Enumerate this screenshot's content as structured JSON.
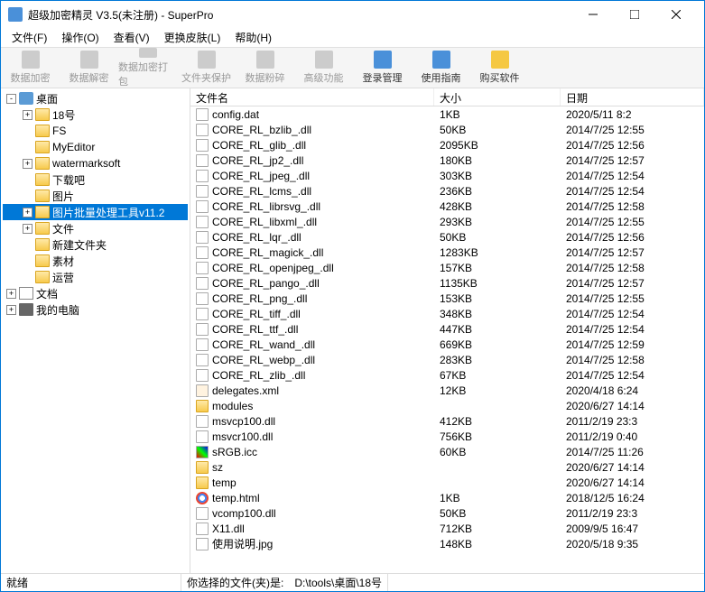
{
  "window": {
    "title": "超级加密精灵 V3.5(未注册) - SuperPro"
  },
  "menus": [
    {
      "label": "文件(F)"
    },
    {
      "label": "操作(O)"
    },
    {
      "label": "查看(V)"
    },
    {
      "label": "更换皮肤(L)"
    },
    {
      "label": "帮助(H)"
    }
  ],
  "toolbar": [
    {
      "label": "数据加密",
      "enabled": false
    },
    {
      "label": "数据解密",
      "enabled": false
    },
    {
      "label": "数据加密打包",
      "enabled": false
    },
    {
      "label": "文件夹保护",
      "enabled": false
    },
    {
      "label": "数据粉碎",
      "enabled": false
    },
    {
      "label": "高级功能",
      "enabled": false
    },
    {
      "label": "登录管理",
      "enabled": true
    },
    {
      "label": "使用指南",
      "enabled": true
    },
    {
      "label": "购买软件",
      "enabled": true,
      "yellow": true
    }
  ],
  "tree": [
    {
      "depth": 0,
      "exp": "-",
      "icon": "desktop",
      "label": "桌面"
    },
    {
      "depth": 1,
      "exp": "+",
      "icon": "folder",
      "label": "18号"
    },
    {
      "depth": 1,
      "exp": "",
      "icon": "folder",
      "label": "FS"
    },
    {
      "depth": 1,
      "exp": "",
      "icon": "folder",
      "label": "MyEditor"
    },
    {
      "depth": 1,
      "exp": "+",
      "icon": "folder",
      "label": "watermarksoft"
    },
    {
      "depth": 1,
      "exp": "",
      "icon": "folder",
      "label": "下载吧"
    },
    {
      "depth": 1,
      "exp": "",
      "icon": "folder",
      "label": "图片"
    },
    {
      "depth": 1,
      "exp": "+",
      "icon": "folder",
      "label": "图片批量处理工具v11.2",
      "selected": true
    },
    {
      "depth": 1,
      "exp": "+",
      "icon": "folder",
      "label": "文件"
    },
    {
      "depth": 1,
      "exp": "",
      "icon": "folder",
      "label": "新建文件夹"
    },
    {
      "depth": 1,
      "exp": "",
      "icon": "folder",
      "label": "素材"
    },
    {
      "depth": 1,
      "exp": "",
      "icon": "folder",
      "label": "运营"
    },
    {
      "depth": 0,
      "exp": "+",
      "icon": "doc",
      "label": "文档"
    },
    {
      "depth": 0,
      "exp": "+",
      "icon": "pc",
      "label": "我的电脑"
    }
  ],
  "columns": {
    "name": "文件名",
    "size": "大小",
    "date": "日期"
  },
  "files": [
    {
      "name": "config.dat",
      "size": "1KB",
      "date": "2020/5/11 8:2",
      "icon": ""
    },
    {
      "name": "CORE_RL_bzlib_.dll",
      "size": "50KB",
      "date": "2014/7/25 12:55",
      "icon": ""
    },
    {
      "name": "CORE_RL_glib_.dll",
      "size": "2095KB",
      "date": "2014/7/25 12:56",
      "icon": ""
    },
    {
      "name": "CORE_RL_jp2_.dll",
      "size": "180KB",
      "date": "2014/7/25 12:57",
      "icon": ""
    },
    {
      "name": "CORE_RL_jpeg_.dll",
      "size": "303KB",
      "date": "2014/7/25 12:54",
      "icon": ""
    },
    {
      "name": "CORE_RL_lcms_.dll",
      "size": "236KB",
      "date": "2014/7/25 12:54",
      "icon": ""
    },
    {
      "name": "CORE_RL_librsvg_.dll",
      "size": "428KB",
      "date": "2014/7/25 12:58",
      "icon": ""
    },
    {
      "name": "CORE_RL_libxml_.dll",
      "size": "293KB",
      "date": "2014/7/25 12:55",
      "icon": ""
    },
    {
      "name": "CORE_RL_lqr_.dll",
      "size": "50KB",
      "date": "2014/7/25 12:56",
      "icon": ""
    },
    {
      "name": "CORE_RL_magick_.dll",
      "size": "1283KB",
      "date": "2014/7/25 12:57",
      "icon": ""
    },
    {
      "name": "CORE_RL_openjpeg_.dll",
      "size": "157KB",
      "date": "2014/7/25 12:58",
      "icon": ""
    },
    {
      "name": "CORE_RL_pango_.dll",
      "size": "1135KB",
      "date": "2014/7/25 12:57",
      "icon": ""
    },
    {
      "name": "CORE_RL_png_.dll",
      "size": "153KB",
      "date": "2014/7/25 12:55",
      "icon": ""
    },
    {
      "name": "CORE_RL_tiff_.dll",
      "size": "348KB",
      "date": "2014/7/25 12:54",
      "icon": ""
    },
    {
      "name": "CORE_RL_ttf_.dll",
      "size": "447KB",
      "date": "2014/7/25 12:54",
      "icon": ""
    },
    {
      "name": "CORE_RL_wand_.dll",
      "size": "669KB",
      "date": "2014/7/25 12:59",
      "icon": ""
    },
    {
      "name": "CORE_RL_webp_.dll",
      "size": "283KB",
      "date": "2014/7/25 12:58",
      "icon": ""
    },
    {
      "name": "CORE_RL_zlib_.dll",
      "size": "67KB",
      "date": "2014/7/25 12:54",
      "icon": ""
    },
    {
      "name": "delegates.xml",
      "size": "12KB",
      "date": "2020/4/18 6:24",
      "icon": "xml"
    },
    {
      "name": "modules",
      "size": "",
      "date": "2020/6/27 14:14",
      "icon": "folder"
    },
    {
      "name": "msvcp100.dll",
      "size": "412KB",
      "date": "2011/2/19 23:3",
      "icon": ""
    },
    {
      "name": "msvcr100.dll",
      "size": "756KB",
      "date": "2011/2/19 0:40",
      "icon": ""
    },
    {
      "name": "sRGB.icc",
      "size": "60KB",
      "date": "2014/7/25 11:26",
      "icon": "icc"
    },
    {
      "name": "sz",
      "size": "",
      "date": "2020/6/27 14:14",
      "icon": "folder"
    },
    {
      "name": "temp",
      "size": "",
      "date": "2020/6/27 14:14",
      "icon": "folder"
    },
    {
      "name": "temp.html",
      "size": "1KB",
      "date": "2018/12/5 16:24",
      "icon": "chrome"
    },
    {
      "name": "vcomp100.dll",
      "size": "50KB",
      "date": "2011/2/19 23:3",
      "icon": ""
    },
    {
      "name": "X11.dll",
      "size": "712KB",
      "date": "2009/9/5 16:47",
      "icon": ""
    },
    {
      "name": "使用说明.jpg",
      "size": "148KB",
      "date": "2020/5/18 9:35",
      "icon": ""
    }
  ],
  "status": {
    "ready": "就绪",
    "sel_label": "你选择的文件(夹)是:",
    "path": "D:\\tools\\桌面\\18号"
  }
}
